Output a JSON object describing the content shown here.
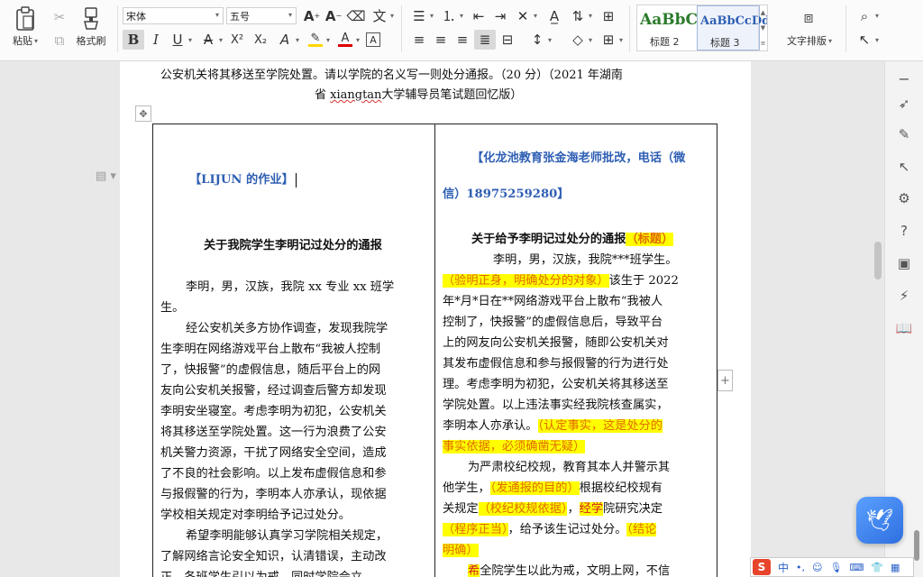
{
  "ribbon": {
    "paste_label": "粘贴",
    "format_painter_label": "格式刷",
    "font_name": "宋体",
    "font_size": "五号",
    "styles": [
      {
        "sample": "AaBbCc",
        "name": "标题 2"
      },
      {
        "sample": "AaBbCcDd",
        "name": "标题 3"
      }
    ],
    "text_layout_label": "文字排版"
  },
  "document": {
    "header_line1": "公安机关将其移送至学院处置。请以学院的名义写一则处分通报。（20 分）（2021 年湖南",
    "header_line2_a": "省 ",
    "header_line2_link": "xiangtan",
    "header_line2_b": "大学辅导员笔试题回忆版）",
    "left": {
      "tag": "【LIJUN 的作业】",
      "title": "关于我院学生李明记过处分的通报",
      "lines": [
        "李明，男，汉族，我院 xx 专业 xx 班学",
        "生。",
        "经公安机关多方协作调查，发现我院学",
        "生李明在网络游戏平台上散布“我被人控制",
        "了，快报警”的虚假信息，随后平台上的网",
        "友向公安机关报警，经过调查后警方却发现",
        "李明安坐寝室。考虑李明为初犯，公安机关",
        "将其移送至学院处置。这一行为浪费了公安",
        "机关警力资源，干扰了网络安全空间，造成",
        "了不良的社会影响。以上发布虚假信息和参",
        "与报假警的行为，李明本人亦承认，现依据",
        "学校相关规定对李明给予记过处分。",
        "希望李明能够认真学习学院相关规定，",
        "了解网络言论安全知识，认清错误，主动改",
        "正。各班学生引以为戒，同时学院会立"
      ]
    },
    "right": {
      "tag_line1": "【化龙池教育张金海老师批改，电话（微",
      "tag_line2": "信）18975259280】",
      "title": "关于给予李明记过处分的通报",
      "title_note": "（标题）",
      "p1_line1": "李明，男，汉族，我院***班学生。",
      "p1_note": "（验明正身，明确处分的对象）",
      "p1_rest": "该生于 2022",
      "lines": [
        "年*月*日在**网络游戏平台上散布“我被人",
        "控制了，快报警”的虚假信息后，导致平台",
        "上的网友向公安机关报警，随即公安机关对",
        "其发布虚假信息和参与报假警的行为进行处",
        "理。考虑李明为初犯，公安机关将其移送至",
        "学院处置。以上违法事实经我院核查属实，"
      ],
      "fact_a": "李明本人亦承认。",
      "fact_note1": "（认定事实，这是处分的",
      "fact_note2": "事实依据，必须确凿无疑）",
      "p3_line1": "为严肃校纪校规，教育其本人并警示其",
      "p3_line2_a": "他学生，",
      "p3_note_purpose": "（发通报的目的）",
      "p3_line2_b": "根据校纪校规有",
      "p3_line3_a": "关规定",
      "p3_note_basis": "（校纪校规依据）",
      "p3_line3_b": "，",
      "p3_line3_mark": "经学",
      "p3_line3_c": "院研究决定",
      "p3_note_proc": "（程序正当）",
      "p3_line4_b": "，给予该生记过处分。",
      "p3_note_concl1": "（结论",
      "p3_note_concl2": "明确）",
      "p4_mark": "希",
      "p4_rest": "全院学生以此为戒，文明上网，不信"
    }
  },
  "ime": {
    "lang": "中"
  },
  "colors": {
    "accent_blue": "#2f5fb3",
    "highlight": "#ffff00",
    "note_orange": "#e06b00"
  }
}
